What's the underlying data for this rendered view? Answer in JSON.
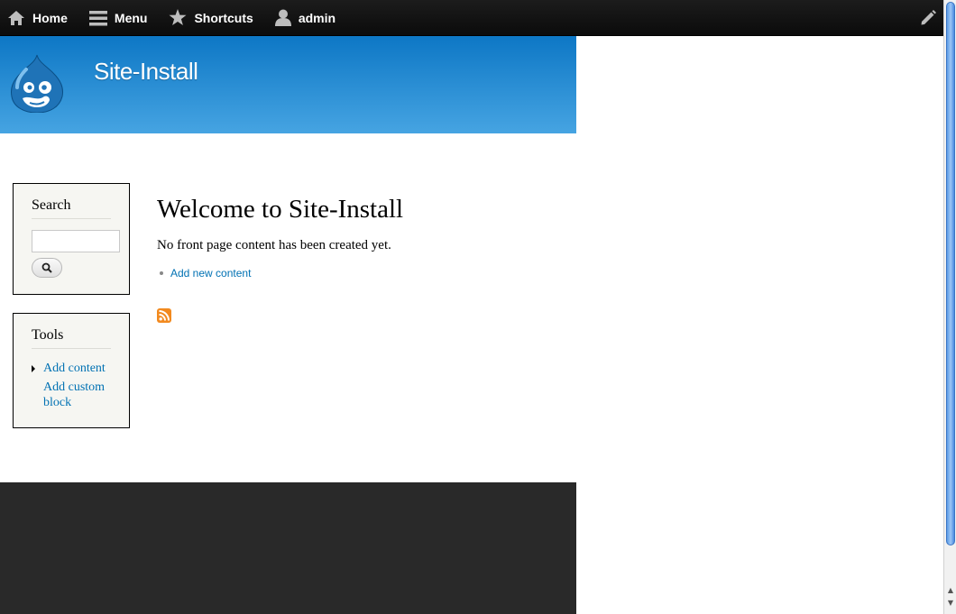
{
  "toolbar": {
    "home": "Home",
    "menu": "Menu",
    "shortcuts": "Shortcuts",
    "user": "admin"
  },
  "header": {
    "site_name": "Site-Install"
  },
  "search_block": {
    "title": "Search",
    "placeholder": ""
  },
  "tools_block": {
    "title": "Tools",
    "items": [
      "Add content",
      "Add custom block"
    ]
  },
  "main": {
    "title": "Welcome to Site-Install",
    "text": "No front page content has been created yet.",
    "link": "Add new content"
  },
  "colors": {
    "header_top": "#0d77c5",
    "header_bottom": "#46a4e2",
    "link": "#0071b3",
    "footer": "#292929",
    "toolbar": "#111111"
  },
  "icons": [
    "home-icon",
    "menu-icon",
    "star-icon",
    "user-icon",
    "pencil-icon",
    "drupal-logo",
    "search-icon",
    "rss-feed-icon"
  ]
}
